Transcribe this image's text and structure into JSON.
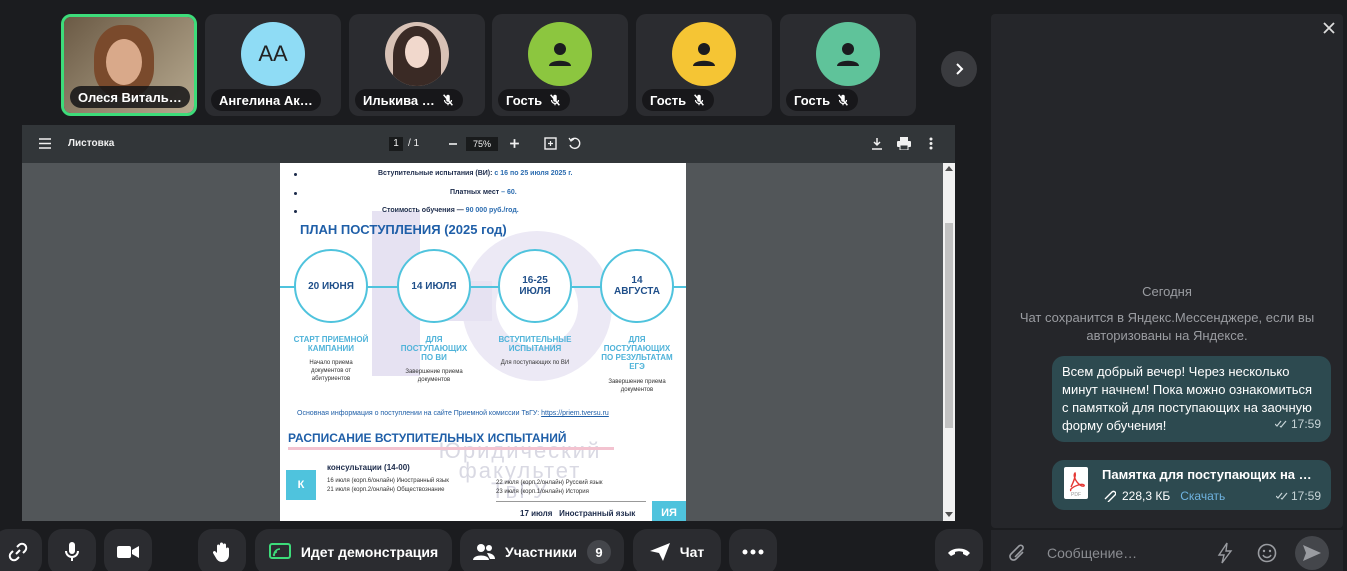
{
  "participants": [
    {
      "name": "Олеся Виталь…",
      "type": "video"
    },
    {
      "name": "Ангелина Ак…",
      "initials": "АА",
      "avatar_color": "#8fdcf5"
    },
    {
      "name": "Илькива …",
      "type": "photo"
    },
    {
      "name": "Гость",
      "avatar_color": "#8cc63f"
    },
    {
      "name": "Гость",
      "avatar_color": "#f5c534"
    },
    {
      "name": "Гость",
      "avatar_color": "#5fc39a"
    }
  ],
  "pdf": {
    "title": "Листовка",
    "page_current": "1",
    "page_total": "/ 1",
    "zoom": "75%",
    "page": {
      "line1_a": "Вступительные испытания (ВИ): ",
      "line1_b": "с 16 по 25 июля 2025 г.",
      "line2_a": "Платных мест",
      "line2_b": " – 60.",
      "line3_a": "Стоимость обучения — ",
      "line3_b": "90 000 руб./год.",
      "plan_title": "ПЛАН ПОСТУПЛЕНИЯ (2025 год)",
      "circles": [
        "20 ИЮНЯ",
        "14 ИЮЛЯ",
        "16-25\nИЮЛЯ",
        "14\nАВГУСТА"
      ],
      "captions": [
        "СТАРТ ПРИЕМНОЙ\nКАМПАНИИ",
        "ДЛЯ\nПОСТУПАЮЩИХ\nПО ВИ",
        "ВСТУПИТЕЛЬНЫЕ\nИСПЫТАНИЯ",
        "ДЛЯ\nПОСТУПАЮЩИХ\nПО РЕЗУЛЬТАТАМ\nЕГЭ"
      ],
      "subs": [
        "Начало приема\nдокументов от\nабитуриентов",
        "Завершение приема\nдокументов",
        "Для поступающих по ВИ",
        "Завершение приема\nдокументов"
      ],
      "info": "Основная информация о поступлении на сайте Приемной комиссии ТвГУ: ",
      "info_link": "https://priem.tversu.ru",
      "schedule_title": "РАСПИСАНИЕ ВСТУПИТЕЛЬНЫХ ИСПЫТАНИЙ",
      "consult_letter": "К",
      "consult_title": "консультации (14-00)",
      "c_row1_left": "16 июля (корп.6/онлайн) Иностранный язык",
      "c_row2_left": "21 июля (корп.2/онлайн) Обществознание",
      "c_row1_right": "22 июля (корп.2/онлайн) Русский язык",
      "c_row2_right": "23 июля (корп.1/онлайн) История",
      "exam_line": "17 июля   Иностранный язык",
      "exam_tag": "ИЯ",
      "watermark1": "Юридический",
      "watermark2": "факультет",
      "watermark3": "ТвГУ"
    }
  },
  "controls": {
    "screen_share": "Идет демонстрация",
    "participants": "Участники",
    "participants_count": "9",
    "chat": "Чат"
  },
  "chat": {
    "day": "Сегодня",
    "notice": "Чат сохранится в Яндекс.Мессенджере, если вы авторизованы на Яндексе.",
    "message1": "Всем добрый вечер! Через несколько минут начнем! Пока можно ознакомиться с памяткой для поступающих на заочную форму обучения!",
    "message1_time": "17:59",
    "file_name": "Памятка для поступающих на …",
    "file_size": "228,3 КБ",
    "file_download": "Скачать",
    "file_time": "17:59",
    "input_placeholder": "Сообщение…"
  },
  "colors": {
    "accent_green": "#3ddc7a",
    "chat_bubble": "#2d4a50",
    "hangup": "#e53935"
  }
}
